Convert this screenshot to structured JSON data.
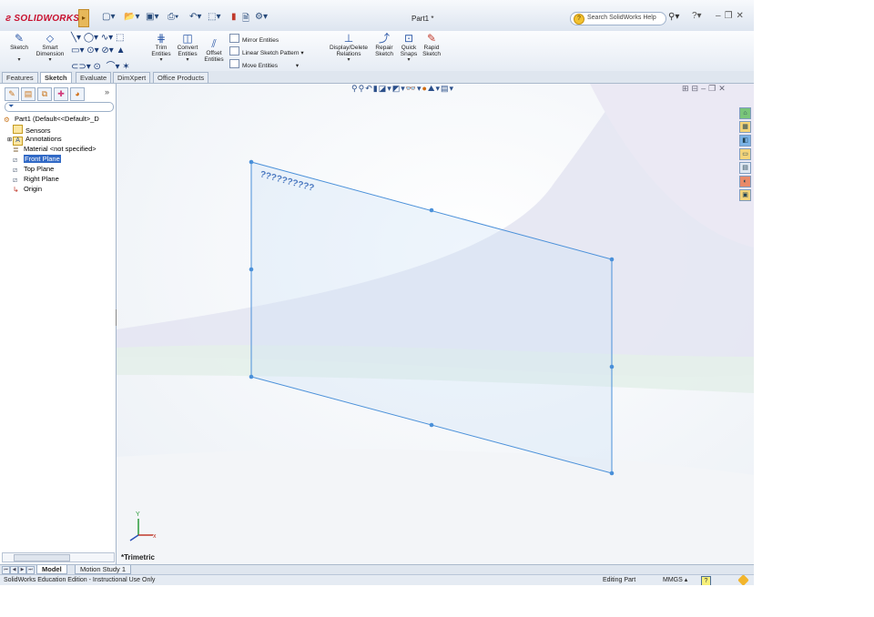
{
  "titlebar": {
    "logo": "SOLIDWORKS",
    "doc_title": "Part1 *",
    "help_search_placeholder": "Search SolidWorks Help"
  },
  "quick_access": {
    "icons": [
      "new-icon",
      "open-icon",
      "save-icon",
      "print-icon",
      "undo-icon",
      "select-icon",
      "rebuild-icon",
      "options-icon"
    ]
  },
  "command_manager": {
    "sketch": "Sketch",
    "smart_dimension_1": "Smart",
    "smart_dimension_2": "Dimension",
    "trim_1": "Trim",
    "trim_2": "Entities",
    "convert_1": "Convert",
    "convert_2": "Entities",
    "offset_1": "Offset",
    "offset_2": "Entities",
    "mirror": "Mirror Entities",
    "linear_pattern": "Linear Sketch Pattern",
    "move": "Move Entities",
    "display_delete_1": "Display/Delete",
    "display_delete_2": "Relations",
    "repair_1": "Repair",
    "repair_2": "Sketch",
    "quick_snaps_1": "Quick",
    "quick_snaps_2": "Snaps",
    "rapid_1": "Rapid",
    "rapid_2": "Sketch"
  },
  "tabs": [
    "Features",
    "Sketch",
    "Evaluate",
    "DimXpert",
    "Office Products"
  ],
  "active_tab": "Sketch",
  "feature_tree": {
    "root": "Part1  (Default<<Default>_D",
    "items": [
      {
        "label": "Sensors",
        "icon": "sensor-icon"
      },
      {
        "label": "Annotations",
        "icon": "annotations-icon"
      },
      {
        "label": "Material <not specified>",
        "icon": "material-icon"
      },
      {
        "label": "Front Plane",
        "icon": "plane-icon",
        "selected": true
      },
      {
        "label": "Top Plane",
        "icon": "plane-icon"
      },
      {
        "label": "Right Plane",
        "icon": "plane-icon"
      },
      {
        "label": "Origin",
        "icon": "origin-icon"
      }
    ]
  },
  "viewport": {
    "plane_label": "??????????",
    "view_orientation": "*Trimetric",
    "colors": {
      "plane_edge": "#4a90d9",
      "plane_fill": "#cfe2f7"
    }
  },
  "bottom_tabs": [
    "Model",
    "Motion Study 1"
  ],
  "statusbar": {
    "left": "SolidWorks Education Edition - Instructional Use Only",
    "mode": "Editing Part",
    "units": "MMGS"
  }
}
